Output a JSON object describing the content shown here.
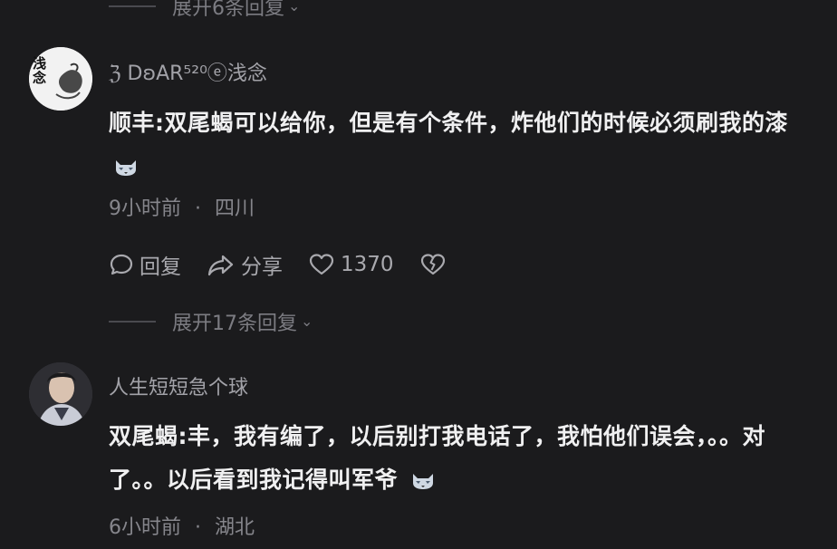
{
  "top_expand": {
    "label": "展开6条回复"
  },
  "comment1": {
    "username": "ℨ DʚAR⁵²⁰ⓔ浅念",
    "avatar_text": "浅念",
    "text": "顺丰:双尾蝎可以给你，但是有个条件，炸他们的时候必须刷我的漆",
    "time": "9小时前",
    "location": "四川",
    "reply_label": "回复",
    "share_label": "分享",
    "likes": "1370"
  },
  "mid_expand": {
    "label": "展开17条回复"
  },
  "comment2": {
    "username": "人生短短急个球",
    "text": "双尾蝎:丰，我有编了，以后别打我电话了，我怕他们误会，。。对了。。以后看到我记得叫军爷",
    "time": "6小时前",
    "location": "湖北"
  },
  "meta_separator": "·",
  "icons": {
    "reply": "speech-bubble-icon",
    "share": "share-arrow-icon",
    "like": "heart-icon",
    "dislike": "broken-heart-icon",
    "emoji": "wolf-emoji-icon",
    "chevron": "chevron-down-icon"
  }
}
